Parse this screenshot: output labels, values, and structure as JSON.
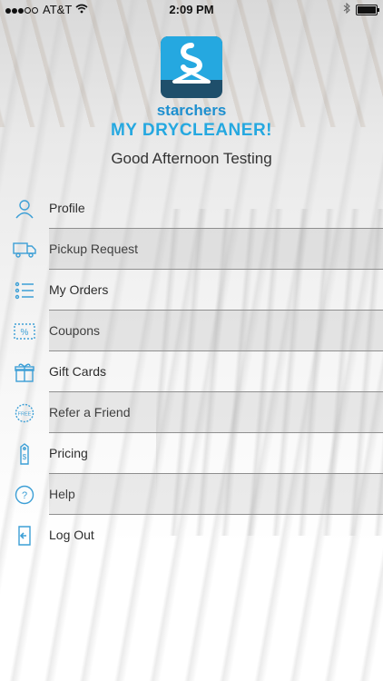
{
  "status_bar": {
    "carrier": "AT&T",
    "time": "2:09 PM",
    "signal_bars_filled": 3,
    "signal_bars_total": 5
  },
  "app": {
    "brand": "starchers",
    "tagline": "MY DRYCLEANER!",
    "greeting": "Good Afternoon Testing"
  },
  "colors": {
    "accent": "#25a8e0",
    "brand_dark": "#1f4f6b",
    "text": "#2d2d2d"
  },
  "menu": {
    "items": [
      {
        "label": "Profile",
        "icon": "person-icon"
      },
      {
        "label": "Pickup Request",
        "icon": "truck-icon"
      },
      {
        "label": "My Orders",
        "icon": "list-icon"
      },
      {
        "label": "Coupons",
        "icon": "coupon-icon"
      },
      {
        "label": "Gift Cards",
        "icon": "gift-icon"
      },
      {
        "label": "Refer a Friend",
        "icon": "free-badge-icon"
      },
      {
        "label": "Pricing",
        "icon": "price-tag-icon"
      },
      {
        "label": "Help",
        "icon": "help-icon"
      },
      {
        "label": "Log Out",
        "icon": "logout-icon"
      }
    ],
    "free_badge_text": "FREE"
  }
}
